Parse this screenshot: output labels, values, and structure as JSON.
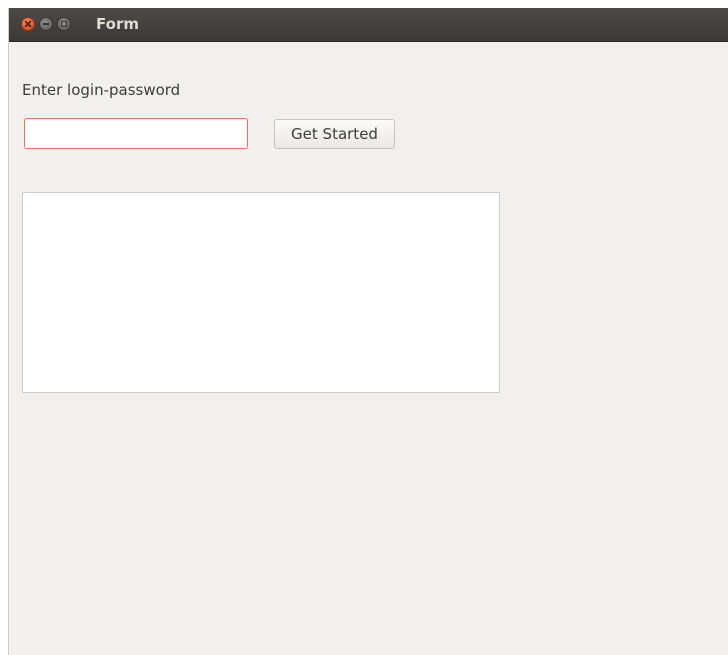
{
  "window": {
    "title": "Form"
  },
  "form": {
    "prompt_label": "Enter login-password",
    "password_value": "",
    "get_started_label": "Get Started",
    "output_text": ""
  },
  "colors": {
    "titlebar": "#3f3e3a",
    "window_background": "#f1f0ef",
    "input_focus_border": "#e0794f",
    "close_button": "#e25b2c"
  },
  "icons": [
    "close-icon",
    "minimize-icon",
    "maximize-icon"
  ]
}
